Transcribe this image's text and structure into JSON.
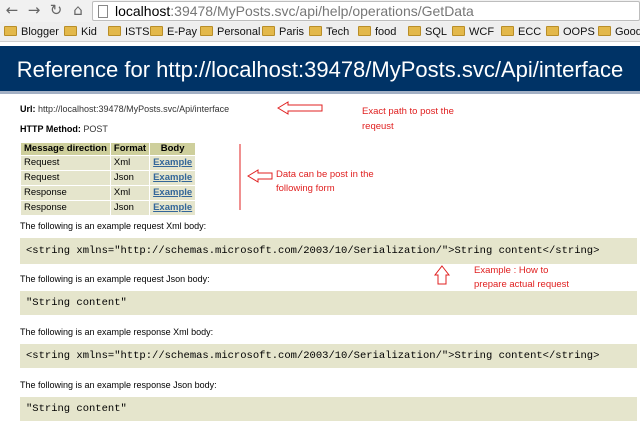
{
  "browser": {
    "url_host": "localhost",
    "url_rest": ":39478/MyPosts.svc/api/help/operations/GetData"
  },
  "bookmarks": [
    {
      "label": "Blogger"
    },
    {
      "label": "Kid"
    },
    {
      "label": "ISTS"
    },
    {
      "label": "E-Pay"
    },
    {
      "label": "Personal"
    },
    {
      "label": "Paris"
    },
    {
      "label": "Tech"
    },
    {
      "label": "food"
    },
    {
      "label": "SQL"
    },
    {
      "label": "WCF"
    },
    {
      "label": "ECC"
    },
    {
      "label": "OOPS"
    },
    {
      "label": "Good"
    }
  ],
  "page": {
    "title": "Reference for http://localhost:39478/MyPosts.svc/Api/interface",
    "url_label": "Url:",
    "url_value": "http://localhost:39478/MyPosts.svc/Api/interface",
    "method_label": "HTTP Method:",
    "method_value": "POST"
  },
  "table": {
    "headers": [
      "Message direction",
      "Format",
      "Body"
    ],
    "rows": [
      {
        "direction": "Request",
        "format": "Xml",
        "body": "Example"
      },
      {
        "direction": "Request",
        "format": "Json",
        "body": "Example"
      },
      {
        "direction": "Response",
        "format": "Xml",
        "body": "Example"
      },
      {
        "direction": "Response",
        "format": "Json",
        "body": "Example"
      }
    ]
  },
  "sections": [
    {
      "label": "The following is an example request Xml body:",
      "code": "<string xmlns=\"http://schemas.microsoft.com/2003/10/Serialization/\">String content</string>"
    },
    {
      "label": "The following is an example request Json body:",
      "code": "\"String content\""
    },
    {
      "label": "The following is an example response Xml body:",
      "code": "<string xmlns=\"http://schemas.microsoft.com/2003/10/Serialization/\">String content</string>"
    },
    {
      "label": "The following is an example response Json body:",
      "code": "\"String content\""
    }
  ],
  "annotations": {
    "path_line1": "Exact path to post the",
    "path_line2": "reqeust",
    "form_line1": "Data can be post in the",
    "form_line2": "following form",
    "example_line1": "Example : How to",
    "example_line2": "prepare actual request"
  },
  "colors": {
    "header_bg": "#003366",
    "table_header": "#cecf9c",
    "table_cell": "#e5e5cc",
    "annotation": "#e02020"
  }
}
